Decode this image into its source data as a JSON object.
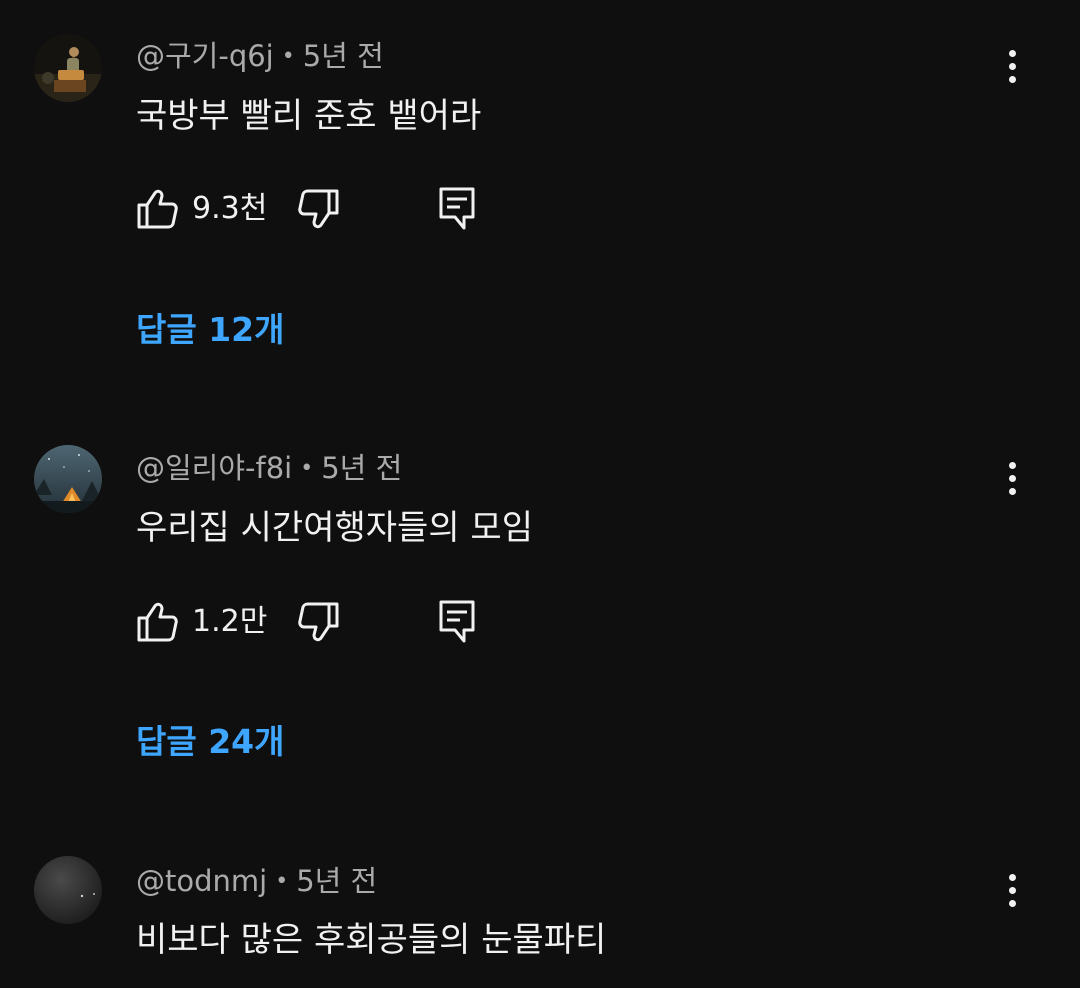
{
  "comments": [
    {
      "handle": "@구기-q6j",
      "time": "5년 전",
      "text": "국방부 빨리 준호 뱉어라",
      "likes": "9.3천",
      "replies_label": "답글 12개"
    },
    {
      "handle": "@일리야-f8i",
      "time": "5년 전",
      "text": "우리집 시간여행자들의 모임",
      "likes": "1.2만",
      "replies_label": "답글 24개"
    },
    {
      "handle": "@todnmj",
      "time": "5년 전",
      "text": "비보다 많은 후회공들의 눈물파티"
    }
  ],
  "separator": "•",
  "icons": {
    "like": "thumbs-up-icon",
    "dislike": "thumbs-down-icon",
    "reply": "comment-icon",
    "menu": "more-vertical-icon"
  },
  "colors": {
    "background": "#0f0f0f",
    "text": "#f1f1f1",
    "meta": "#aaaaaa",
    "link": "#3ea6ff"
  }
}
